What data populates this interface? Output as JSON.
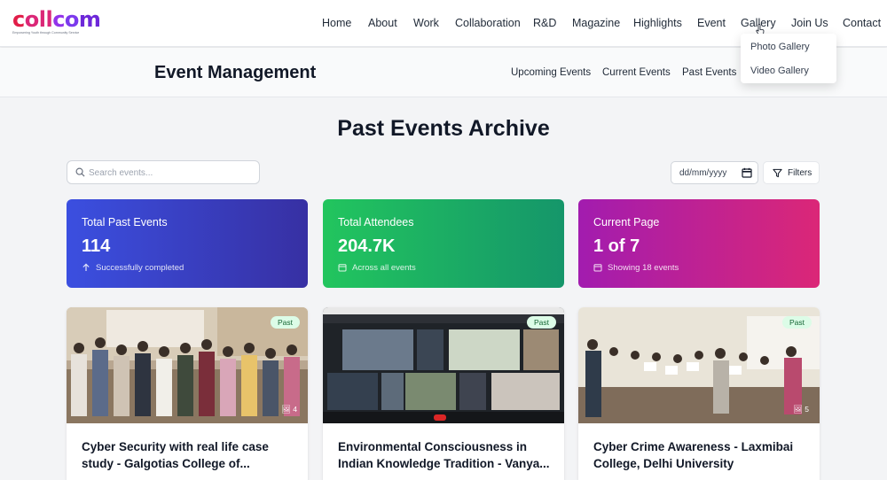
{
  "brand": {
    "name": "collcom",
    "tagline": "Empowering Youth through Community Service"
  },
  "nav": {
    "items": [
      "Home",
      "About",
      "Work",
      "Collaboration",
      "R&D",
      "Magazine",
      "Highlights",
      "Event",
      "Gallery",
      "Join Us",
      "Contact"
    ],
    "gallery_dropdown": [
      "Photo Gallery",
      "Video Gallery"
    ]
  },
  "subheader": {
    "title": "Event Management",
    "links": [
      "Upcoming Events",
      "Current Events",
      "Past Events"
    ]
  },
  "page": {
    "heading": "Past Events Archive",
    "search_placeholder": "Search events...",
    "date_placeholder": "dd/mm/yyyy",
    "filters_label": "Filters"
  },
  "stats": [
    {
      "label": "Total Past Events",
      "value": "114",
      "sub": "Successfully completed",
      "icon": "arrow-up-icon",
      "colors": [
        "#3b4fe0",
        "#3730a3"
      ]
    },
    {
      "label": "Total Attendees",
      "value": "204.7K",
      "sub": "Across all events",
      "icon": "calendar-icon",
      "colors": [
        "#22c55e",
        "#15966a"
      ]
    },
    {
      "label": "Current Page",
      "value": "1 of 7",
      "sub": "Showing 18 events",
      "icon": "calendar-icon",
      "colors": [
        "#a21caf",
        "#db2777"
      ]
    }
  ],
  "cards": [
    {
      "badge": "Past",
      "image_count": "4",
      "title": "Cyber Security with real life case study - Galgotias College of..."
    },
    {
      "badge": "Past",
      "image_count": "",
      "title": "Environmental Consciousness in Indian Knowledge Tradition - Vanya..."
    },
    {
      "badge": "Past",
      "image_count": "5",
      "title": "Cyber Crime Awareness - Laxmibai College, Delhi University"
    }
  ]
}
